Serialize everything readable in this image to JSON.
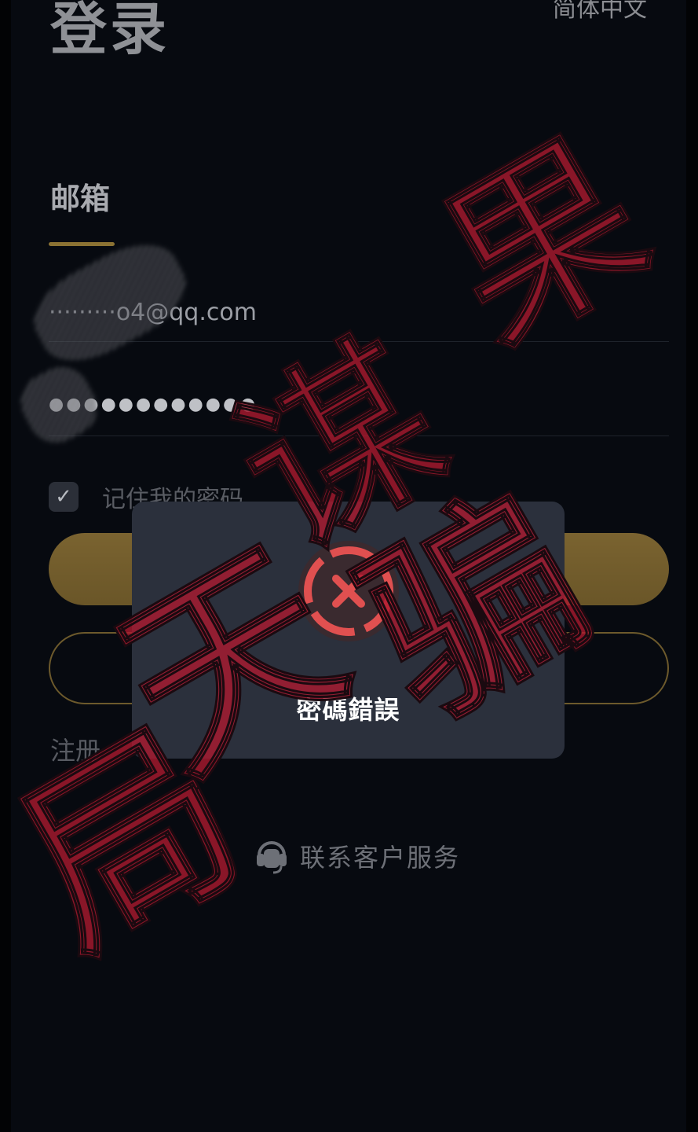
{
  "page": {
    "title": "登录",
    "language": "简体中文"
  },
  "tabs": {
    "email": "邮箱"
  },
  "form": {
    "email_value": "·········o4@qq.com",
    "password_value": "●●●●●●●●●●●●",
    "remember_label": "记住我的密码",
    "remember_checked": true,
    "login_label": "",
    "secondary_label": ""
  },
  "links": {
    "register": "注册",
    "support": "联系客户服务"
  },
  "toast": {
    "message": "密碼錯誤",
    "icon": "error-icon"
  },
  "watermark": {
    "text": "果天谋骗局"
  },
  "colors": {
    "background": "#070a10",
    "accent_gold": "#8b7233",
    "toast_bg": "#2b303c",
    "error_red": "#e05050",
    "watermark_red": "#b01a30"
  }
}
